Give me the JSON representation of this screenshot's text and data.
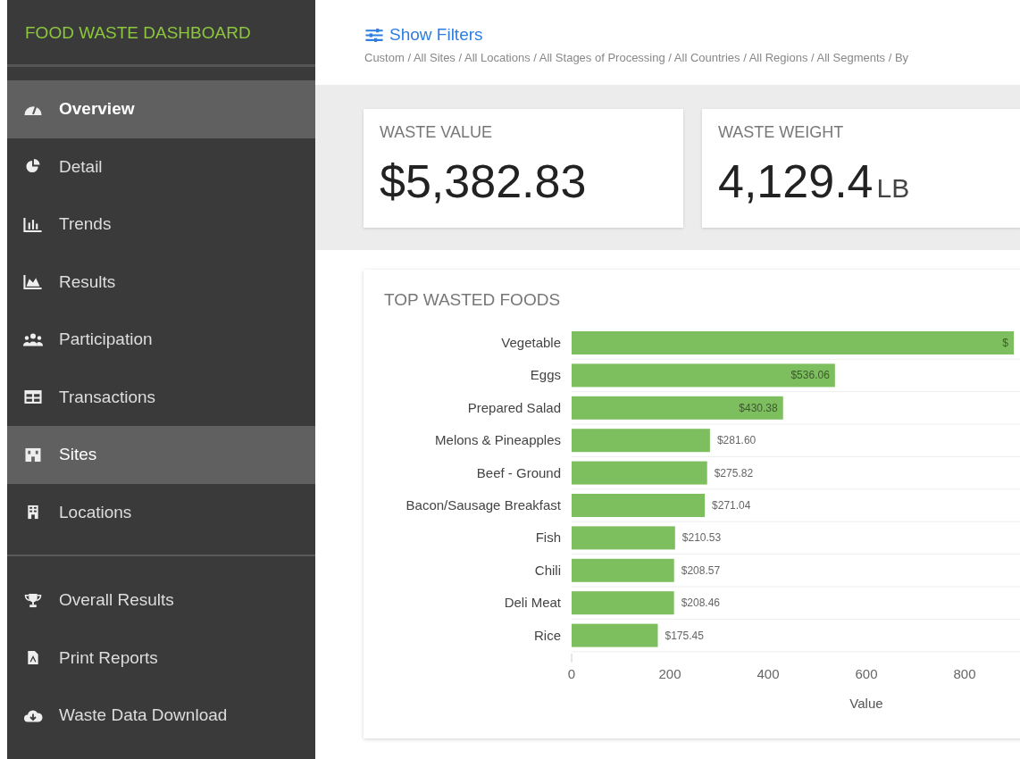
{
  "sidebar": {
    "title": "FOOD WASTE DASHBOARD",
    "nav_main": [
      {
        "label": "Overview",
        "selected": true
      },
      {
        "label": "Detail",
        "selected": false
      },
      {
        "label": "Trends",
        "selected": false
      },
      {
        "label": "Results",
        "selected": false
      },
      {
        "label": "Participation",
        "selected": false
      },
      {
        "label": "Transactions",
        "selected": false
      },
      {
        "label": "Sites",
        "selected": true
      },
      {
        "label": "Locations",
        "selected": false
      }
    ],
    "nav_secondary": [
      {
        "label": "Overall Results",
        "selected": false
      },
      {
        "label": "Print Reports",
        "selected": false
      },
      {
        "label": "Waste Data Download",
        "selected": false
      }
    ]
  },
  "filters": {
    "button": "Show Filters",
    "breadcrumb": "Custom / All Sites / All Locations / All Stages of Processing / All Countries / All Regions / All Segments / By"
  },
  "stats": [
    {
      "label": "WASTE VALUE",
      "value": "$5,382.83"
    },
    {
      "label": "WASTE WEIGHT",
      "value": "4,129.4",
      "unit": "LB"
    }
  ],
  "top_wasted_foods": {
    "title": "TOP WASTED FOODS",
    "chart_data": {
      "type": "bar",
      "orientation": "horizontal",
      "xlabel": "Value",
      "categories": [
        "Vegetable",
        "Eggs",
        "Prepared Salad",
        "Melons & Pineapples",
        "Beef - Ground",
        "Bacon/Sausage Breakfast",
        "Fish",
        "Chili",
        "Deli Meat",
        "Rice"
      ],
      "values": [
        900,
        536.06,
        430.38,
        281.6,
        275.82,
        271.04,
        210.53,
        208.57,
        208.46,
        175.45
      ],
      "value_labels": [
        "$",
        "$536.06",
        "$430.38",
        "$281.60",
        "$275.82",
        "$271.04",
        "$210.53",
        "$208.57",
        "$208.46",
        "$175.45"
      ],
      "xlim": [
        0,
        900
      ],
      "xticks": [
        0,
        200,
        400,
        600,
        800
      ]
    }
  }
}
